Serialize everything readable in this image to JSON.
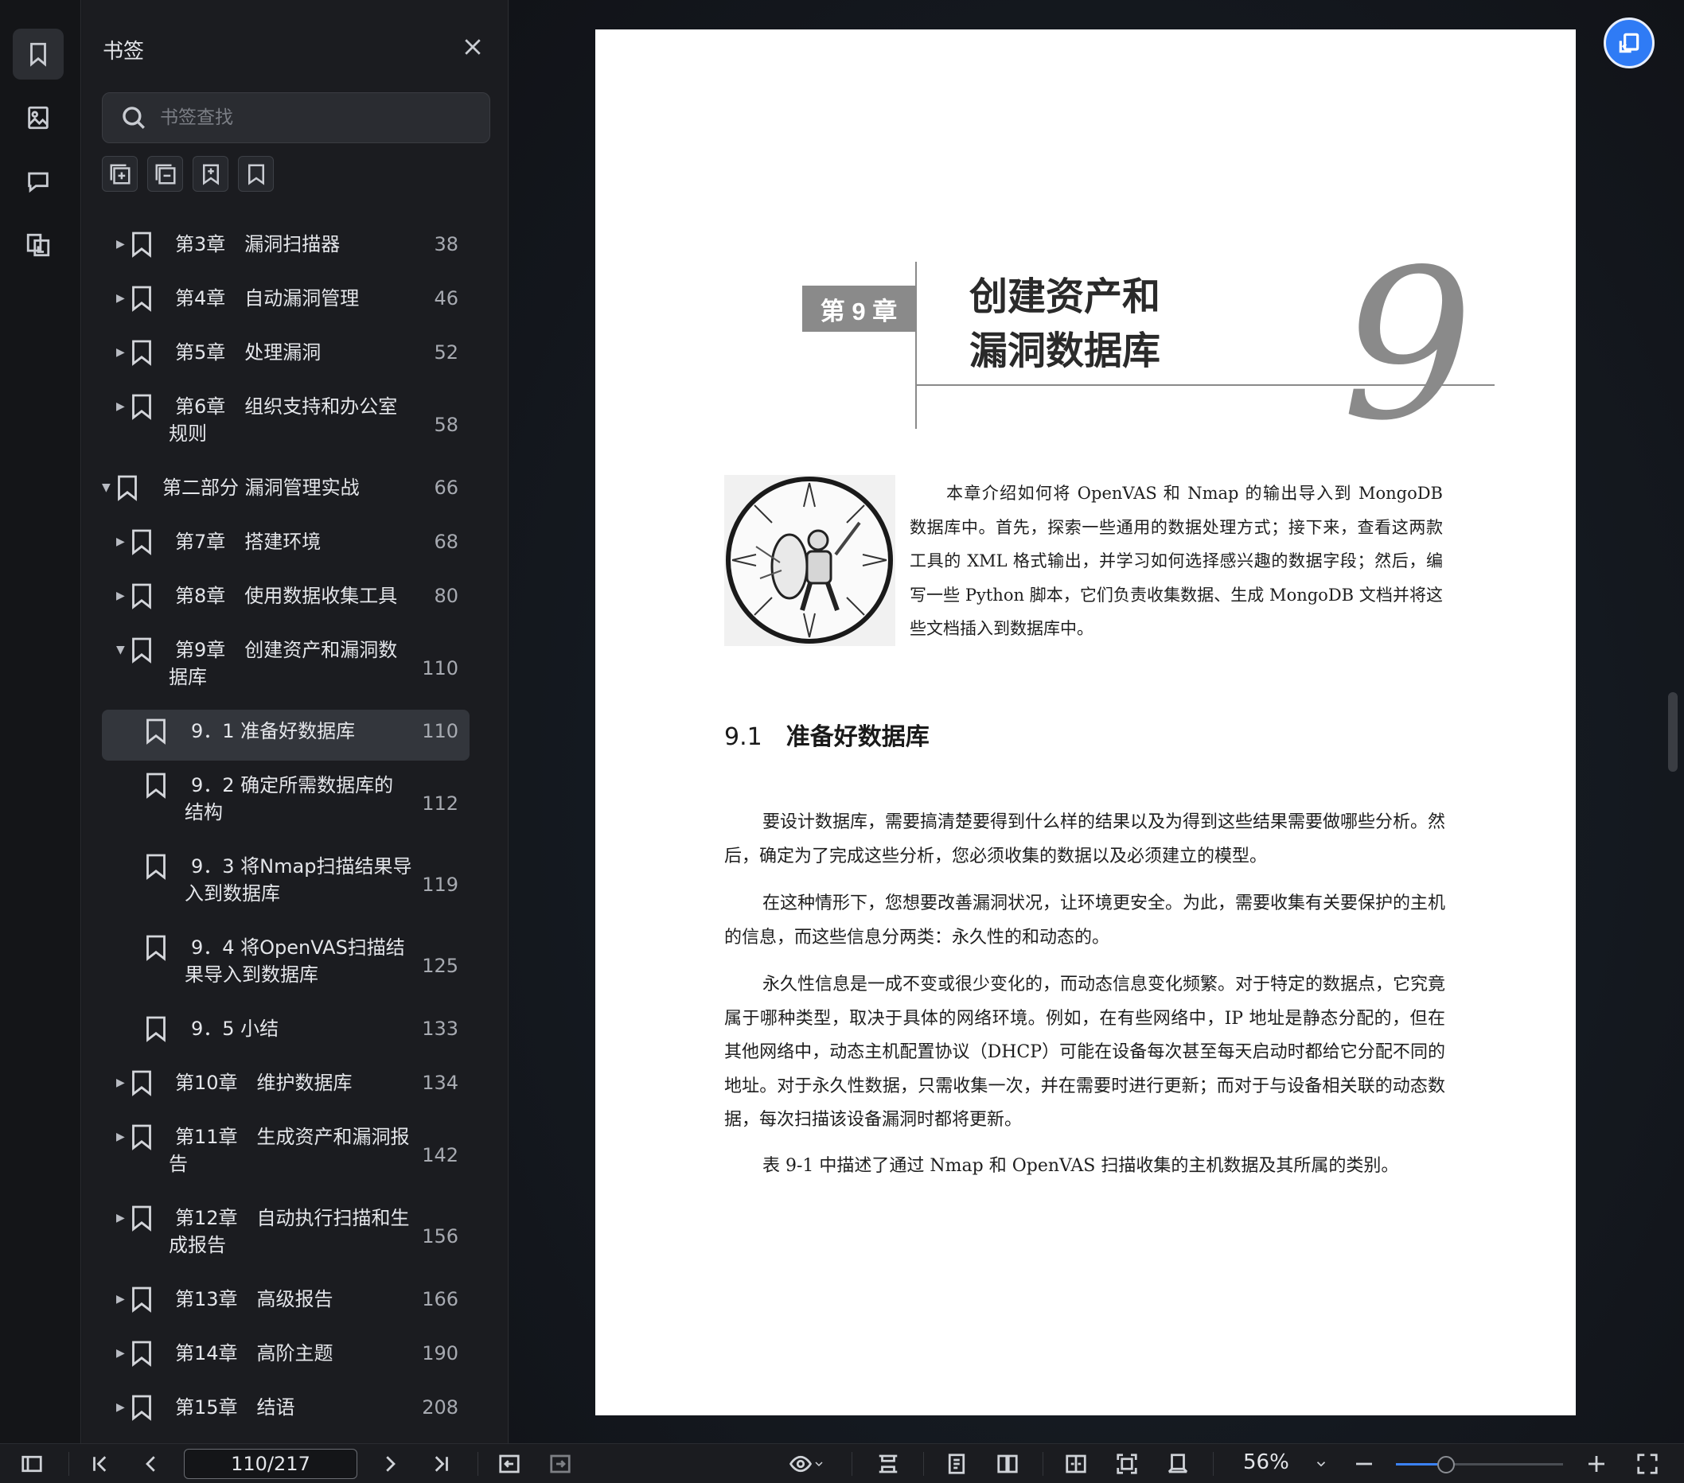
{
  "panel": {
    "title": "书签",
    "search_placeholder": "书签查找"
  },
  "bookmarks": [
    {
      "label": "第3章　漏洞扫描器",
      "page": "38",
      "caret": "right"
    },
    {
      "label": "第4章　自动漏洞管理",
      "page": "46",
      "caret": "right"
    },
    {
      "label": "第5章　处理漏洞",
      "page": "52",
      "caret": "right"
    },
    {
      "label": "第6章　组织支持和办公室",
      "label2": "规则",
      "page": "58",
      "caret": "right"
    },
    {
      "label": "第二部分 漏洞管理实战",
      "page": "66",
      "caret": "down"
    },
    {
      "label": "第7章　搭建环境",
      "page": "68",
      "caret": "right"
    },
    {
      "label": "第8章　使用数据收集工具",
      "page": "80",
      "caret": "right"
    },
    {
      "label": "第9章　创建资产和漏洞数",
      "label2": "据库",
      "page": "110",
      "caret": "down"
    },
    {
      "label": "9．1 准备好数据库",
      "page": "110",
      "caret": "none"
    },
    {
      "label": "9．2 确定所需数据库的",
      "label2": "结构",
      "page": "112",
      "caret": "none"
    },
    {
      "label": "9．3 将Nmap扫描结果导",
      "label2": "入到数据库",
      "page": "119",
      "caret": "none"
    },
    {
      "label": "9．4 将OpenVAS扫描结",
      "label2": "果导入到数据库",
      "page": "125",
      "caret": "none"
    },
    {
      "label": "9．5 小结",
      "page": "133",
      "caret": "none"
    },
    {
      "label": "第10章　维护数据库",
      "page": "134",
      "caret": "right"
    },
    {
      "label": "第11章　生成资产和漏洞报",
      "label2": "告",
      "page": "142",
      "caret": "right"
    },
    {
      "label": "第12章　自动执行扫描和生",
      "label2": "成报告",
      "page": "156",
      "caret": "right"
    },
    {
      "label": "第13章　高级报告",
      "page": "166",
      "caret": "right"
    },
    {
      "label": "第14章　高阶主题",
      "page": "190",
      "caret": "right"
    },
    {
      "label": "第15章　结语",
      "page": "208",
      "caret": "right"
    }
  ],
  "document": {
    "chapter_badge": "第 9 章",
    "chapter_title_line1": "创建资产和",
    "chapter_title_line2": "漏洞数据库",
    "chapter_number": "9",
    "intro": "本章介绍如何将 OpenVAS 和 Nmap 的输出导入到 MongoDB 数据库中。首先，探索一些通用的数据处理方式；接下来，查看这两款工具的 XML 格式输出，并学习如何选择感兴趣的数据字段；然后，编写一些 Python 脚本，它们负责收集数据、生成 MongoDB 文档并将这些文档插入到数据库中。",
    "section_number": "9.1",
    "section_title": "准备好数据库",
    "paragraphs": [
      "要设计数据库，需要搞清楚要得到什么样的结果以及为得到这些结果需要做哪些分析。然后，确定为了完成这些分析，您必须收集的数据以及必须建立的模型。",
      "在这种情形下，您想要改善漏洞状况，让环境更安全。为此，需要收集有关要保护的主机的信息，而这些信息分两类：永久性的和动态的。",
      "永久性信息是一成不变或很少变化的，而动态信息变化频繁。对于特定的数据点，它究竟属于哪种类型，取决于具体的网络环境。例如，在有些网络中，IP 地址是静态分配的，但在其他网络中，动态主机配置协议（DHCP）可能在设备每次甚至每天启动时都给它分配不同的地址。对于永久性数据，只需收集一次，并在需要时进行更新；而对于与设备相关联的动态数据，每次扫描该设备漏洞时都将更新。",
      "表 9-1 中描述了通过 Nmap 和 OpenVAS 扫描收集的主机数据及其所属的类别。"
    ]
  },
  "toolbar": {
    "page_indicator": "110/217",
    "zoom": "56%",
    "zoom_level_fraction": 0.3
  }
}
